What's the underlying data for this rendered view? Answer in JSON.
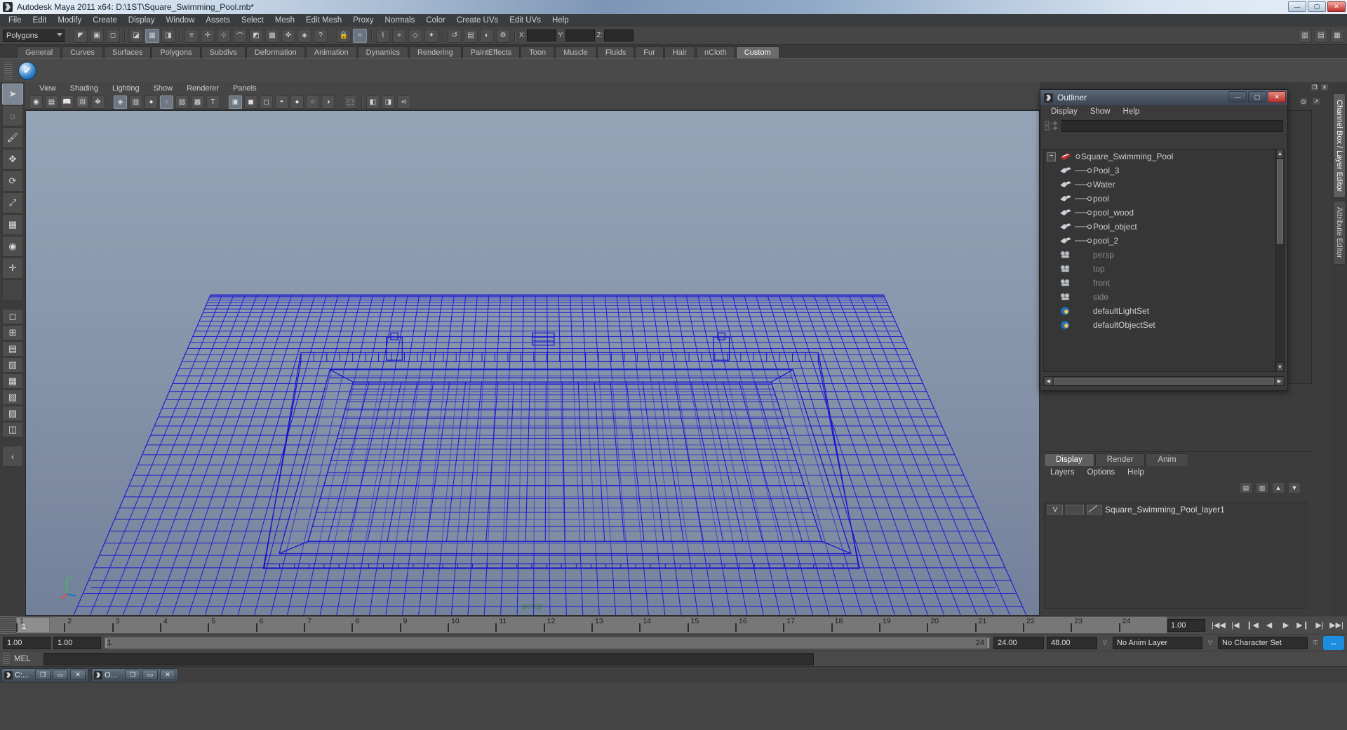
{
  "window": {
    "title": "Autodesk Maya 2011 x64: D:\\1ST\\Square_Swimming_Pool.mb*",
    "minimize": "—",
    "maximize": "▢",
    "close": "✕"
  },
  "menubar": {
    "items": [
      "File",
      "Edit",
      "Modify",
      "Create",
      "Display",
      "Window",
      "Assets",
      "Select",
      "Mesh",
      "Edit Mesh",
      "Proxy",
      "Normals",
      "Color",
      "Create UVs",
      "Edit UVs",
      "Help"
    ]
  },
  "statusline": {
    "mode_selector": "Polygons",
    "x_label": "X:",
    "y_label": "Y:",
    "z_label": "Z:",
    "x_value": "",
    "y_value": "",
    "z_value": ""
  },
  "shelf": {
    "tabs": [
      "General",
      "Curves",
      "Surfaces",
      "Polygons",
      "Subdivs",
      "Deformation",
      "Animation",
      "Dynamics",
      "Rendering",
      "PaintEffects",
      "Toon",
      "Muscle",
      "Fluids",
      "Fur",
      "Hair",
      "nCloth",
      "Custom"
    ],
    "active_tab": "Custom"
  },
  "viewport": {
    "menus": [
      "View",
      "Shading",
      "Lighting",
      "Show",
      "Renderer",
      "Panels"
    ],
    "camera_label": "persp",
    "axis": {
      "x": "x",
      "y": "y",
      "z": "z"
    }
  },
  "outliner": {
    "title": "Outliner",
    "minimize": "—",
    "maximize": "▢",
    "close": "✕",
    "menus": [
      "Display",
      "Show",
      "Help"
    ],
    "search_value": "",
    "root": {
      "label": "Square_Swimming_Pool",
      "expander": "−"
    },
    "children": [
      "Pool_3",
      "Water",
      "pool",
      "pool_wood",
      "Pool_object",
      "pool_2"
    ],
    "cameras": [
      "persp",
      "top",
      "front",
      "side"
    ],
    "sets": [
      "defaultLightSet",
      "defaultObjectSet"
    ]
  },
  "right_tabs": {
    "items": [
      "Channel Box / Layer Editor",
      "Attribute Editor"
    ],
    "active": "Channel Box / Layer Editor"
  },
  "layer_editor": {
    "tabs": [
      "Display",
      "Render",
      "Anim"
    ],
    "active_tab": "Display",
    "menus": [
      "Layers",
      "Options",
      "Help"
    ],
    "layers": [
      {
        "visibility": "V",
        "name": "Square_Swimming_Pool_layer1"
      }
    ]
  },
  "timeline": {
    "ticks": [
      "1",
      "2",
      "3",
      "4",
      "5",
      "6",
      "7",
      "8",
      "9",
      "10",
      "11",
      "12",
      "13",
      "14",
      "15",
      "16",
      "17",
      "18",
      "19",
      "20",
      "21",
      "22",
      "23",
      "24"
    ],
    "current_frame_label": "1",
    "current_time_field": "1.00"
  },
  "playback": {
    "buttons": [
      "go-to-start",
      "step-back-key",
      "step-back-frame",
      "play-backwards",
      "play-forwards",
      "step-forward-frame",
      "step-forward-key",
      "go-to-end"
    ]
  },
  "range": {
    "anim_start": "1.00",
    "range_start": "1.00",
    "bar_start": "1",
    "bar_end": "24",
    "range_end": "24.00",
    "anim_end": "48.00",
    "anim_layer": "No Anim Layer",
    "character_set": "No Character Set"
  },
  "command_line": {
    "label": "MEL",
    "value": ""
  },
  "taskbar": {
    "windows": [
      {
        "label": "C:...",
        "restore": "❐",
        "maximize": "▭",
        "close": "✕"
      },
      {
        "label": "O...",
        "restore": "❐",
        "maximize": "▭",
        "close": "✕"
      }
    ]
  },
  "colors": {
    "wireframe": "#1414c8",
    "viewport_top": "#8e9db2",
    "viewport_bottom": "#76839a",
    "persp_text": "#3d7a3d",
    "accent_close": "#c2302a"
  }
}
